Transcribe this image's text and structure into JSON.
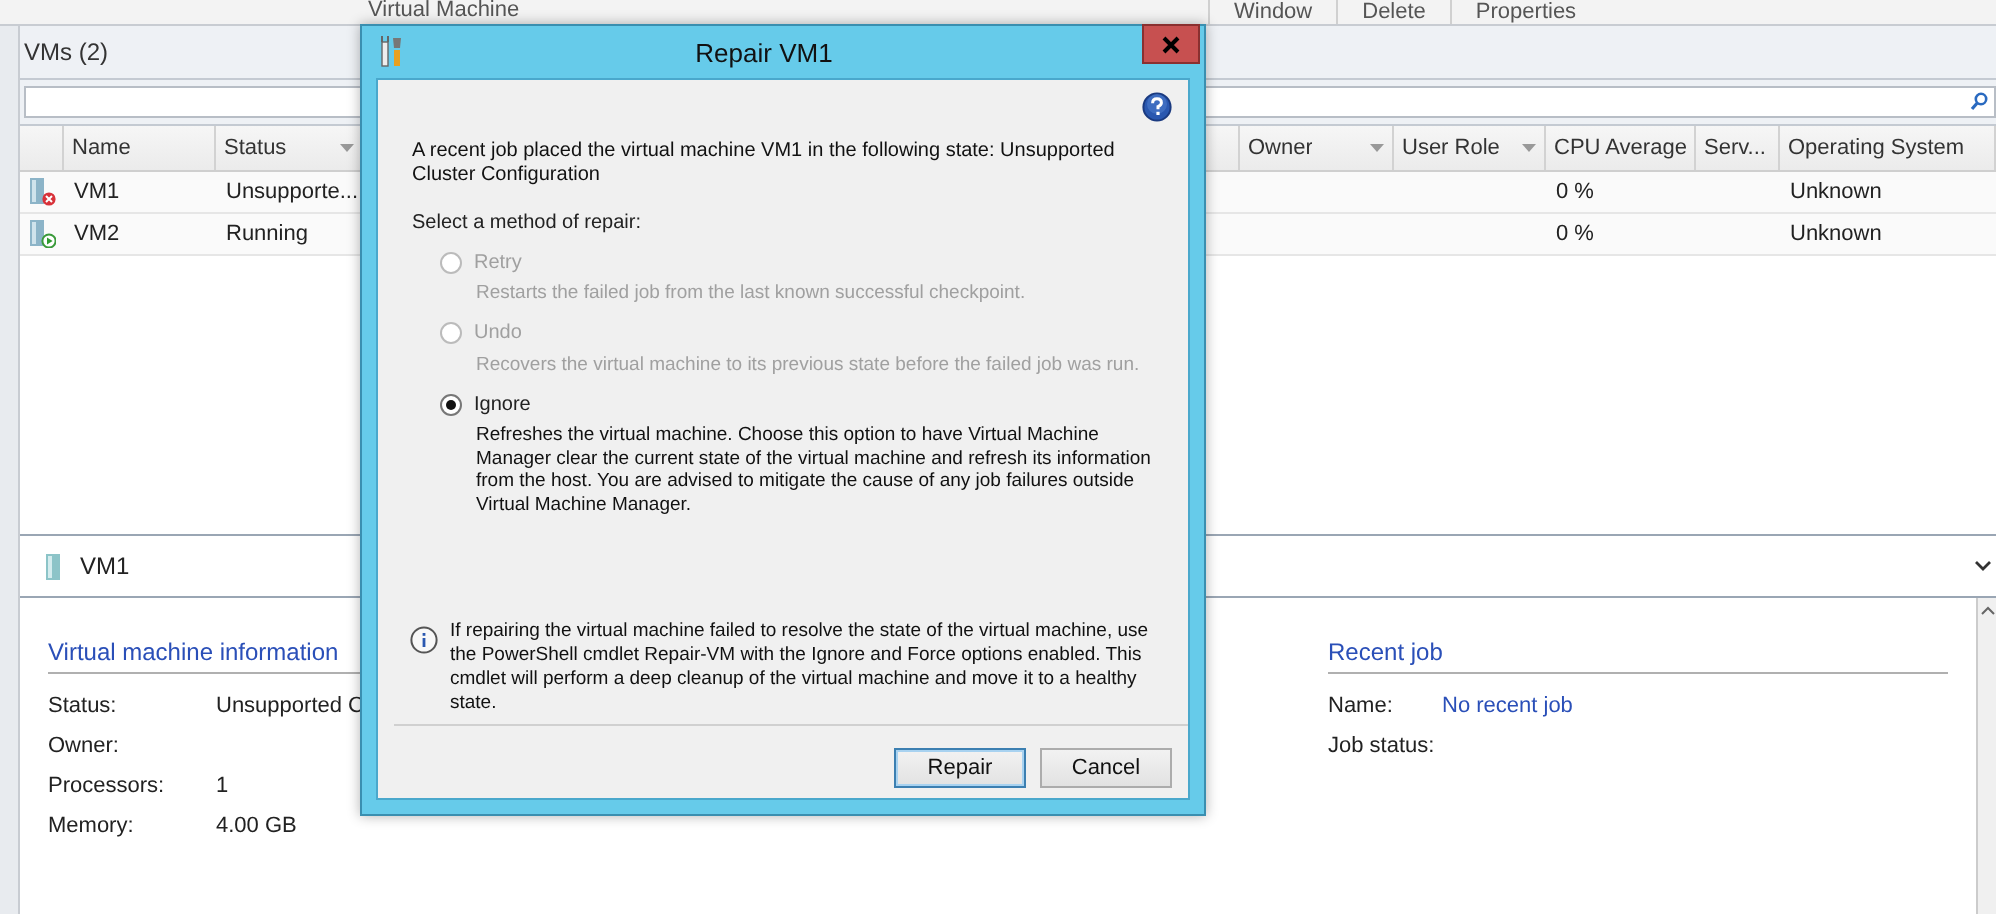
{
  "ribbon": {
    "group_label": "Virtual Machine",
    "buttons": [
      "Window",
      "Delete",
      "Properties"
    ]
  },
  "vms_panel": {
    "title": "VMs (2)"
  },
  "table": {
    "columns": [
      {
        "label": "Name",
        "filter": false
      },
      {
        "label": "Status",
        "filter": true
      },
      {
        "label": "Owner",
        "filter": true
      },
      {
        "label": "User Role",
        "filter": true
      },
      {
        "label": "CPU Average",
        "filter": false
      },
      {
        "label": "Serv...",
        "filter": false
      },
      {
        "label": "Operating System",
        "filter": false
      }
    ],
    "rows": [
      {
        "kind": "error",
        "cells": [
          "VM1",
          "Unsupporte...",
          "",
          "",
          "0 %",
          "",
          "Unknown"
        ]
      },
      {
        "kind": "running",
        "cells": [
          "VM2",
          "Running",
          "",
          "",
          "0 %",
          "",
          "Unknown"
        ]
      }
    ]
  },
  "details": {
    "title": "VM1",
    "sections": [
      {
        "title": "Virtual machine information",
        "fields": [
          {
            "label": "Status:",
            "value": "Unsupported C",
            "link": false
          },
          {
            "label": "Owner:"
          },
          {
            "label": "Processors:",
            "value": "1",
            "link": false
          },
          {
            "label": "Memory:",
            "value": "4.00 GB",
            "link": false
          }
        ]
      },
      {
        "title": "Recent job",
        "fields": [
          {
            "label": "Name:",
            "value": "No recent job",
            "link": true
          },
          {
            "label": "Job status:"
          }
        ]
      }
    ]
  },
  "dialog": {
    "title": "Repair VM1",
    "message": "A recent job placed the virtual machine VM1 in the following state: Unsupported Cluster Configuration",
    "prompt": "Select a method of repair:",
    "options": [
      {
        "label": "Retry",
        "description": "Restarts the failed job from the last known successful checkpoint.",
        "selected": false,
        "disabled": true
      },
      {
        "label": "Undo",
        "description": "Recovers the virtual machine to its previous state before the failed job was run.",
        "selected": false,
        "disabled": true
      },
      {
        "label": "Ignore",
        "description": "Refreshes the virtual machine. Choose this option to have Virtual Machine Manager clear the current state of the virtual machine and refresh its information from the host. You are advised to mitigate the cause of any job failures outside Virtual Machine Manager.",
        "selected": true,
        "disabled": false
      }
    ],
    "note": "If repairing the virtual machine failed to resolve the state of the virtual machine, use the PowerShell cmdlet Repair-VM with the Ignore and Force options enabled. This cmdlet will perform a deep cleanup of the virtual machine and move it to a healthy state.",
    "buttons": [
      {
        "label": "Repair",
        "default": true
      },
      {
        "label": "Cancel",
        "default": false
      }
    ]
  }
}
